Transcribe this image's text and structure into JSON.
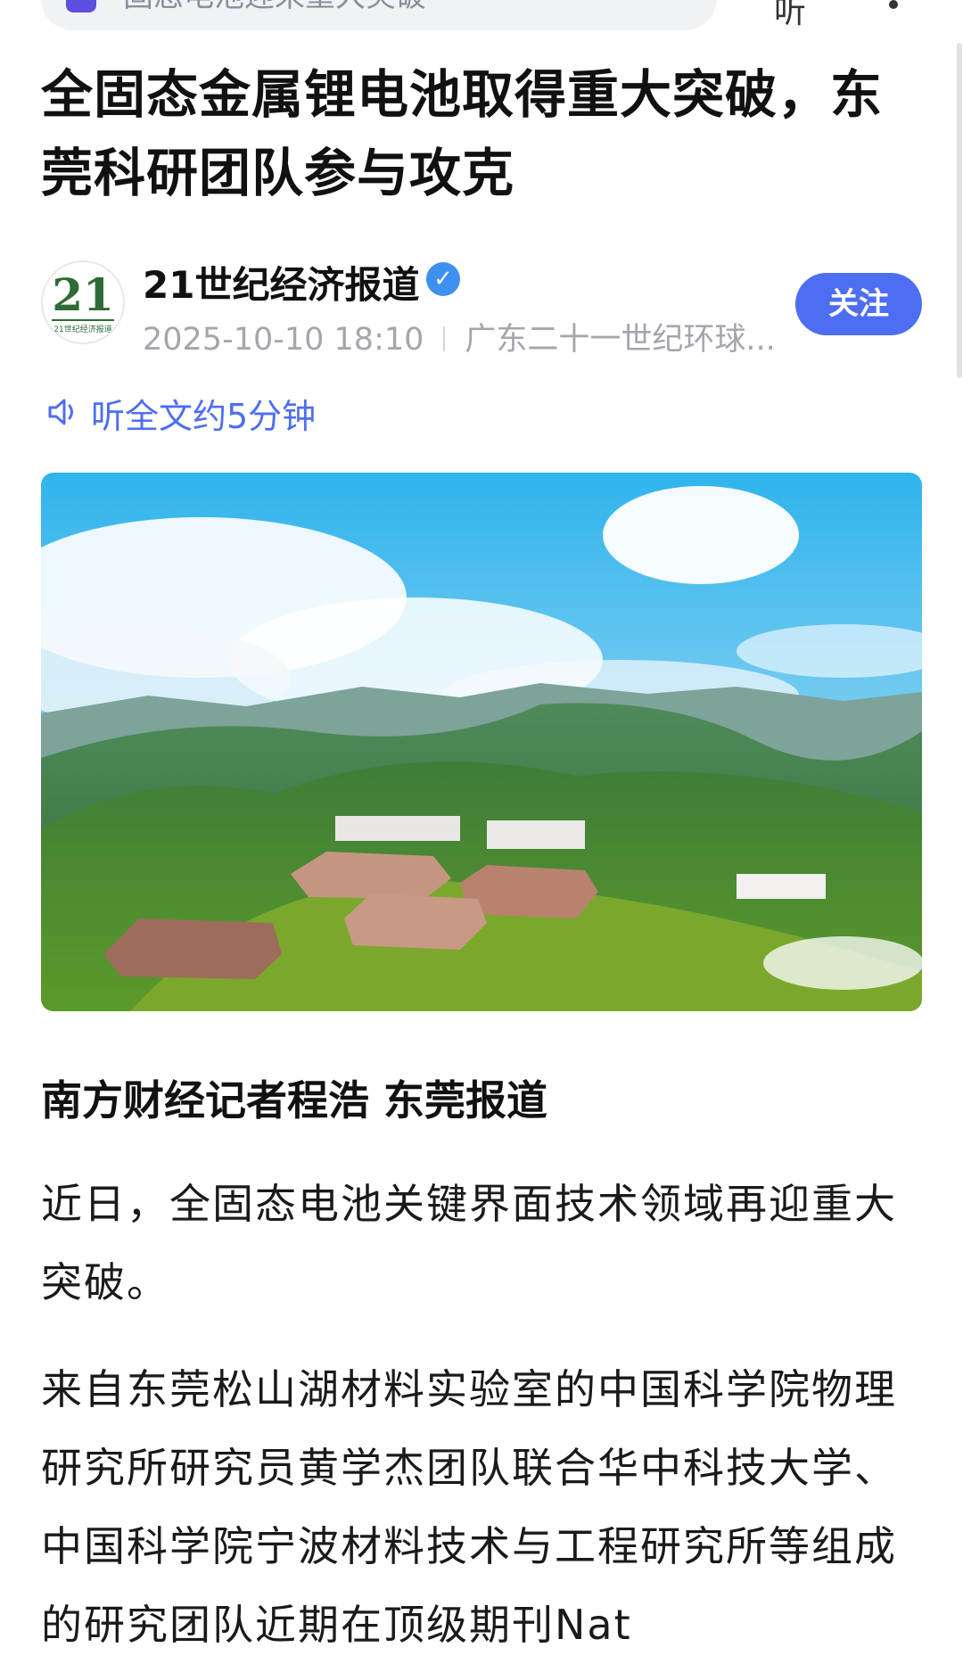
{
  "topbar": {
    "search_query": "固态电池迎来重大突破",
    "right_action": "听"
  },
  "article": {
    "title": "全固态金属锂电池取得重大突破，东莞科研团队参与攻克",
    "author": {
      "name": "21世纪经济报道",
      "avatar_text": "21",
      "avatar_subtext": "21世纪经济报道",
      "date": "2025-10-10 18:10",
      "source": "广东二十一世纪环球..."
    },
    "follow_label": "关注",
    "listen_label": "听全文约5分钟",
    "byline": "南方财经记者程浩 东莞报道",
    "paragraphs": [
      "近日，全固态电池关键界面技术领域再迎重大突破。",
      "来自东莞松山湖材料实验室的中国科学院物理研究所研究员黄学杰团队联合华中科技大学、中国科学院宁波材料技术与工程研究所等组成的研究团队近期在顶级期刊Nat"
    ]
  },
  "colors": {
    "accent": "#4e6ef2",
    "verified": "#3d8ff0",
    "meta_gray": "#a3a6ad"
  }
}
